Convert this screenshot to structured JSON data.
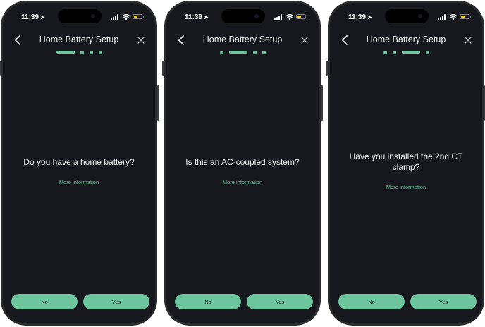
{
  "status_bar": {
    "time": "11:39"
  },
  "screens": [
    {
      "title": "Home Battery Setup",
      "question": "Do you have a home battery?",
      "more_info": "More information",
      "no_label": "No",
      "yes_label": "Yes",
      "progress": {
        "total_steps": 4,
        "current_step": 1
      }
    },
    {
      "title": "Home Battery Setup",
      "question": "Is this an AC-coupled system?",
      "more_info": "More information",
      "no_label": "No",
      "yes_label": "Yes",
      "progress": {
        "total_steps": 4,
        "current_step": 2
      }
    },
    {
      "title": "Home Battery Setup",
      "question": "Have you installed the 2nd CT clamp?",
      "more_info": "More information",
      "no_label": "No",
      "yes_label": "Yes",
      "progress": {
        "total_steps": 4,
        "current_step": 3
      }
    }
  ],
  "colors": {
    "accent": "#6cc59c",
    "screen_bg": "#17181d",
    "battery_level": "#f5d60b"
  }
}
